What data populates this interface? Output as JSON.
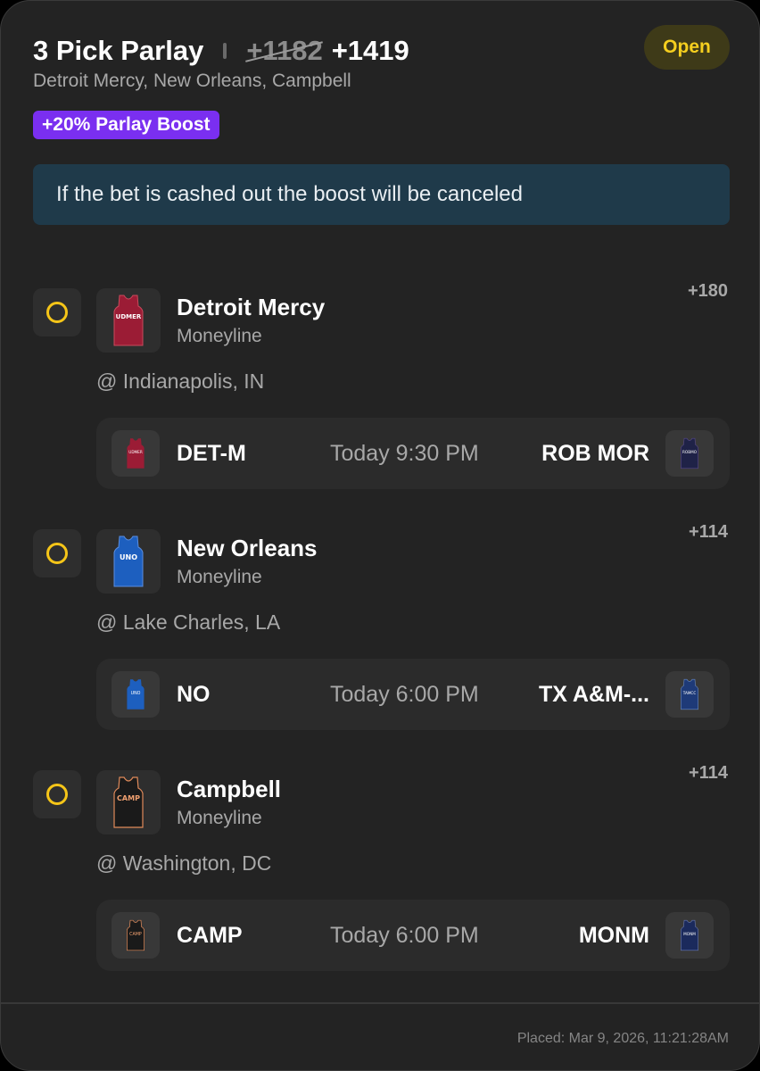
{
  "header": {
    "title": "3 Pick Parlay",
    "old_odds": "+1182",
    "new_odds": "+1419",
    "status": "Open",
    "subtitle": "Detroit Mercy, New Orleans, Campbell",
    "boost": "+20% Parlay Boost"
  },
  "notice": "If the bet is cashed out the boost will be canceled",
  "legs": [
    {
      "team": "Detroit Mercy",
      "market": "Moneyline",
      "odds": "+180",
      "location": "@ Indianapolis, IN",
      "jersey_label": "UDMER",
      "jersey_color": "#9b1c35",
      "matchup": {
        "home": "DET-M",
        "time": "Today 9:30 PM",
        "away": "ROB MOR",
        "home_jersey_label": "UDMER",
        "home_jersey_color": "#9b1c35",
        "away_jersey_label": "ROBMO",
        "away_jersey_color": "#1f2247"
      }
    },
    {
      "team": "New Orleans",
      "market": "Moneyline",
      "odds": "+114",
      "location": "@ Lake Charles, LA",
      "jersey_label": "UNO",
      "jersey_color": "#1d5fbf",
      "matchup": {
        "home": "NO",
        "time": "Today 6:00 PM",
        "away": "TX A&M-...",
        "home_jersey_label": "UNO",
        "home_jersey_color": "#1d5fbf",
        "away_jersey_label": "TAMCC",
        "away_jersey_color": "#1e3a78"
      }
    },
    {
      "team": "Campbell",
      "market": "Moneyline",
      "odds": "+114",
      "location": "@ Washington, DC",
      "jersey_label": "CAMP",
      "jersey_color": "#1a1a1a",
      "matchup": {
        "home": "CAMP",
        "time": "Today 6:00 PM",
        "away": "MONM",
        "home_jersey_label": "CAMP",
        "home_jersey_color": "#1a1a1a",
        "away_jersey_label": "MONM",
        "away_jersey_color": "#1b2a5c"
      }
    }
  ],
  "footer": {
    "placed": "Placed: Mar 9, 2026, 11:21:28AM"
  },
  "colors": {
    "accent_status": "#f5cf1f",
    "boost": "#7a2ff0",
    "notice_bg": "#1f3a4a",
    "pick_ring": "#f5c518"
  }
}
